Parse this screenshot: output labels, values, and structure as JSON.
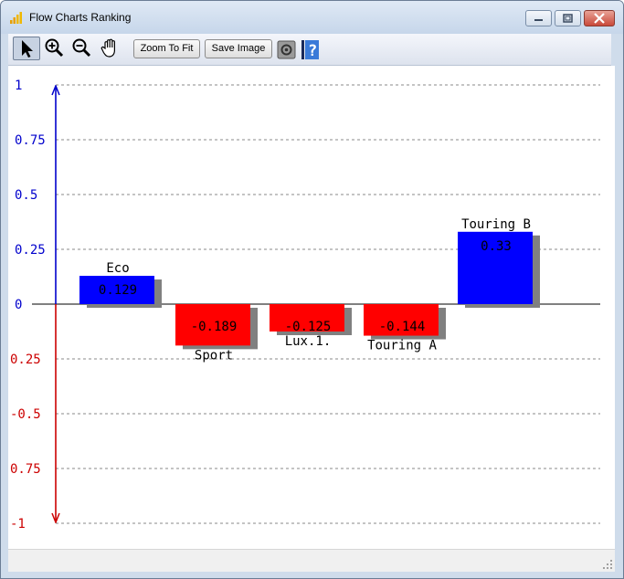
{
  "window": {
    "title": "Flow Charts Ranking"
  },
  "toolbar": {
    "tools": [
      "select-pointer",
      "zoom-in",
      "zoom-out",
      "pan-hand"
    ],
    "zoom_to_fit_label": "Zoom To Fit",
    "save_image_label": "Save Image"
  },
  "icons": [
    "chart-bar-icon",
    "arrow-pointer-icon",
    "zoom-in-icon",
    "zoom-out-icon",
    "hand-pan-icon",
    "settings-icon",
    "help-icon",
    "minimize-icon",
    "maximize-icon",
    "close-icon"
  ],
  "colors": {
    "positive": "#0000ff",
    "negative": "#ff0000",
    "shadow": "#808080",
    "axis_pos": "#0000cc",
    "axis_neg": "#cc0000"
  },
  "chart_data": {
    "type": "bar",
    "categories": [
      "Eco",
      "Sport",
      "Lux.1.",
      "Touring A",
      "Touring B"
    ],
    "values": [
      0.129,
      -0.189,
      -0.125,
      -0.144,
      0.33
    ],
    "value_labels": [
      "0.129",
      "-0.189",
      "-0.125",
      "-0.144",
      "0.33"
    ],
    "ylim": [
      -1,
      1
    ],
    "yticks": [
      1,
      0.75,
      0.5,
      0.25,
      0,
      -0.25,
      -0.5,
      -0.75,
      -1
    ],
    "ytick_labels": [
      "1",
      "0.75",
      "0.5",
      "0.25",
      "0",
      "0.25",
      "-0.5",
      "0.75",
      "-1"
    ],
    "grid": true
  }
}
